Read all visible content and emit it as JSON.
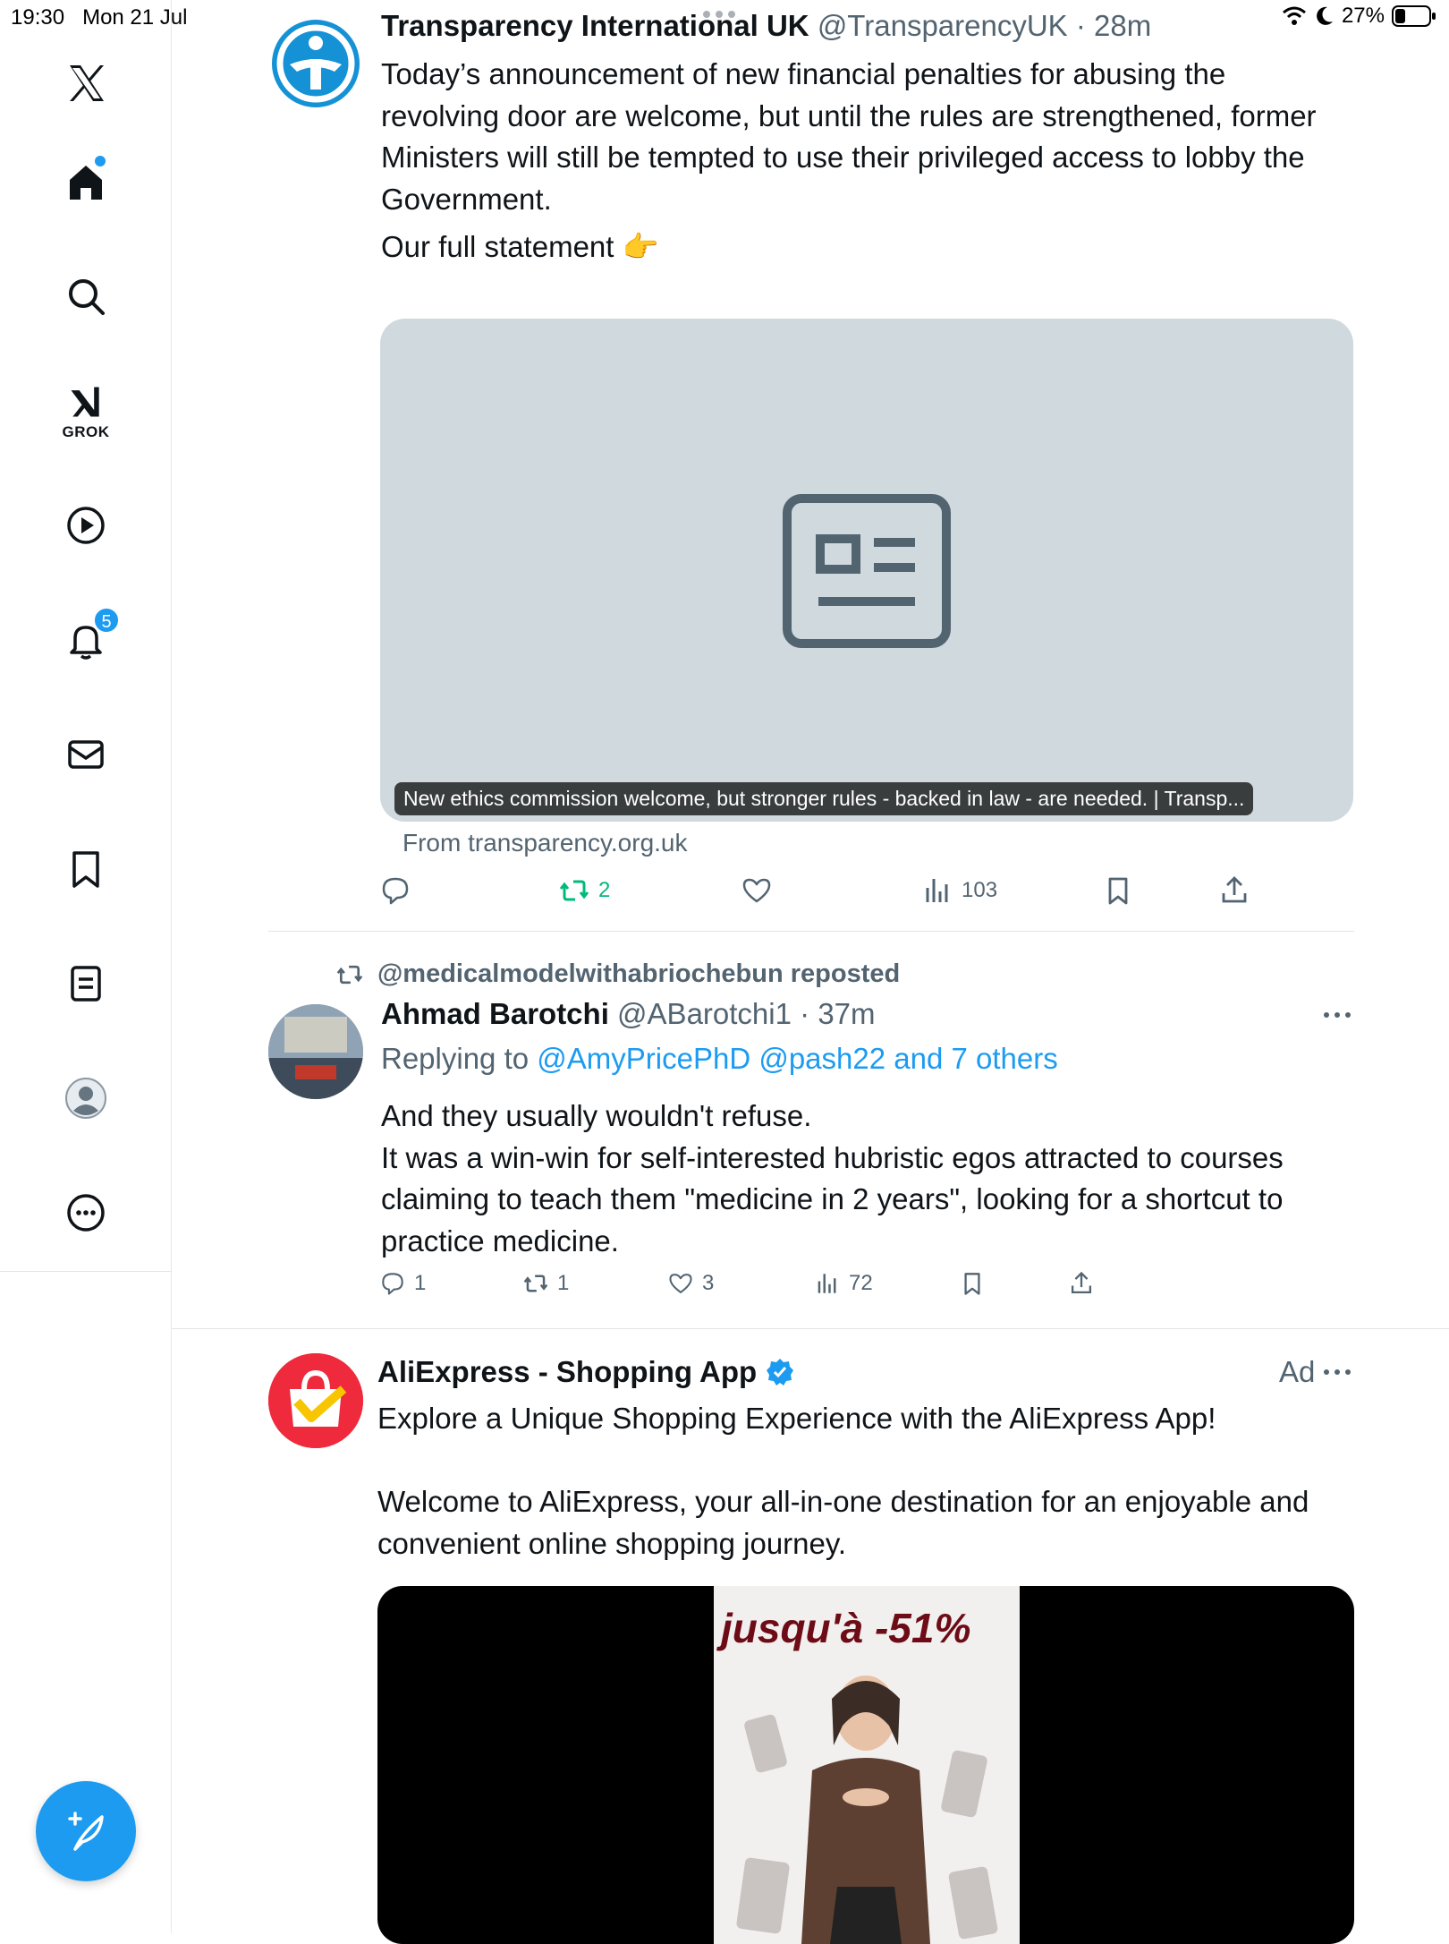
{
  "status_bar": {
    "time": "19:30",
    "date": "Mon 21 Jul",
    "battery": "27%"
  },
  "sidebar": {
    "grok_label": "GROK",
    "notifications_badge": "5"
  },
  "tweet1": {
    "author_name": "Transparency International UK",
    "handle": "@TransparencyUK",
    "time": "28m",
    "text_lines": [
      "Today’s announcement of new financial penalties for abusing the",
      "revolving door are welcome, but until the rules are strengthened, former",
      "Ministers will still be tempted to use their privileged access to lobby the",
      "Government."
    ],
    "text_line2": "Our full statement 👉",
    "card_caption": "New ethics commission welcome, but stronger rules - backed in law - are needed. | Transp...",
    "card_source": "From transparency.org.uk",
    "reposts": "2",
    "views": "103"
  },
  "tweet2": {
    "repost_label": "@medicalmodelwithabriochebun reposted",
    "author_name": "Ahmad Barotchi",
    "handle": "@ABarotchi1",
    "time": "37m",
    "replying_prefix": "Replying to",
    "replying_to": "@AmyPricePhD @pash22 and 7 others",
    "text_lines": [
      "And they usually wouldn't refuse.",
      "It was a win-win for self-interested hubristic egos attracted to courses",
      "claiming to teach them \"medicine in 2 years\", looking for a shortcut to",
      "practice medicine."
    ],
    "replies": "1",
    "reposts": "1",
    "likes": "3",
    "views": "72"
  },
  "tweet3": {
    "author_name": "AliExpress - Shopping App",
    "ad_label": "Ad",
    "text_lines": [
      "Explore a Unique Shopping Experience with the AliExpress App!",
      "",
      "Welcome to AliExpress, your all-in-one destination for an enjoyable and",
      "convenient online shopping journey."
    ],
    "media_headline": "jusqu'à -51%"
  },
  "colors": {
    "accent": "#1d9bf0",
    "repost_green": "#00ba7c",
    "text": "#0f1419",
    "secondary": "#536471",
    "card_bg": "#cfd9de"
  }
}
